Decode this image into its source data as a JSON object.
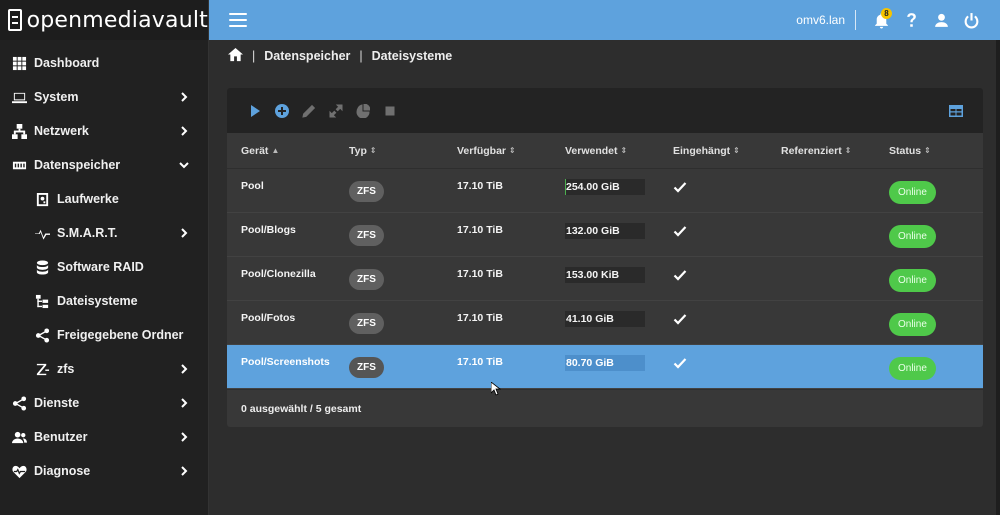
{
  "brand": {
    "name": "openmediavault"
  },
  "sidebar": {
    "items": [
      {
        "label": "Dashboard",
        "icon": "dashboard-icon",
        "has_children": false
      },
      {
        "label": "System",
        "icon": "laptop-icon",
        "has_children": true
      },
      {
        "label": "Netzwerk",
        "icon": "network-icon",
        "has_children": true
      },
      {
        "label": "Datenspeicher",
        "icon": "storage-icon",
        "has_children": true,
        "expanded": true
      },
      {
        "label": "Laufwerke",
        "icon": "harddisk-icon",
        "sub": true
      },
      {
        "label": "S.M.A.R.T.",
        "icon": "pulse-icon",
        "sub": true,
        "has_children": true
      },
      {
        "label": "Software RAID",
        "icon": "database-icon",
        "sub": true
      },
      {
        "label": "Dateisysteme",
        "icon": "file-tree-icon",
        "sub": true
      },
      {
        "label": "Freigegebene Ordner",
        "icon": "share-icon",
        "sub": true
      },
      {
        "label": "zfs",
        "icon": "zfs-icon",
        "sub": true,
        "has_children": true
      },
      {
        "label": "Dienste",
        "icon": "share-icon",
        "has_children": true
      },
      {
        "label": "Benutzer",
        "icon": "users-icon",
        "has_children": true
      },
      {
        "label": "Diagnose",
        "icon": "heart-pulse-icon",
        "has_children": true
      }
    ]
  },
  "topbar": {
    "host": "omv6.lan",
    "notification_count": "8"
  },
  "breadcrumb": {
    "items": [
      "Datenspeicher",
      "Dateisysteme"
    ]
  },
  "table": {
    "columns": [
      "Gerät",
      "Typ",
      "Verfügbar",
      "Verwendet",
      "Eingehängt",
      "Referenziert",
      "Status"
    ],
    "rows": [
      {
        "device": "Pool",
        "type": "ZFS",
        "available": "17.10 TiB",
        "used": "254.00 GiB",
        "used_fraction": 0.014,
        "mounted": true,
        "referenced": "",
        "status": "Online",
        "selected": false
      },
      {
        "device": "Pool/Blogs",
        "type": "ZFS",
        "available": "17.10 TiB",
        "used": "132.00 GiB",
        "used_fraction": 0.0,
        "mounted": true,
        "referenced": "",
        "status": "Online",
        "selected": false
      },
      {
        "device": "Pool/Clonezilla",
        "type": "ZFS",
        "available": "17.10 TiB",
        "used": "153.00 KiB",
        "used_fraction": 0.0,
        "mounted": true,
        "referenced": "",
        "status": "Online",
        "selected": false
      },
      {
        "device": "Pool/Fotos",
        "type": "ZFS",
        "available": "17.10 TiB",
        "used": "41.10 GiB",
        "used_fraction": 0.0,
        "mounted": true,
        "referenced": "",
        "status": "Online",
        "selected": false
      },
      {
        "device": "Pool/Screenshots",
        "type": "ZFS",
        "available": "17.10 TiB",
        "used": "80.70 GiB",
        "used_fraction": 0.0,
        "mounted": true,
        "referenced": "",
        "status": "Online",
        "selected": true
      }
    ],
    "footer": "0 ausgewählt / 5 gesamt"
  },
  "colors": {
    "accent": "#5ea2dd",
    "status_online": "#4fc94a",
    "sidebar_bg": "#212121",
    "content_bg": "#2d2d2d",
    "card_bg": "#383838"
  }
}
